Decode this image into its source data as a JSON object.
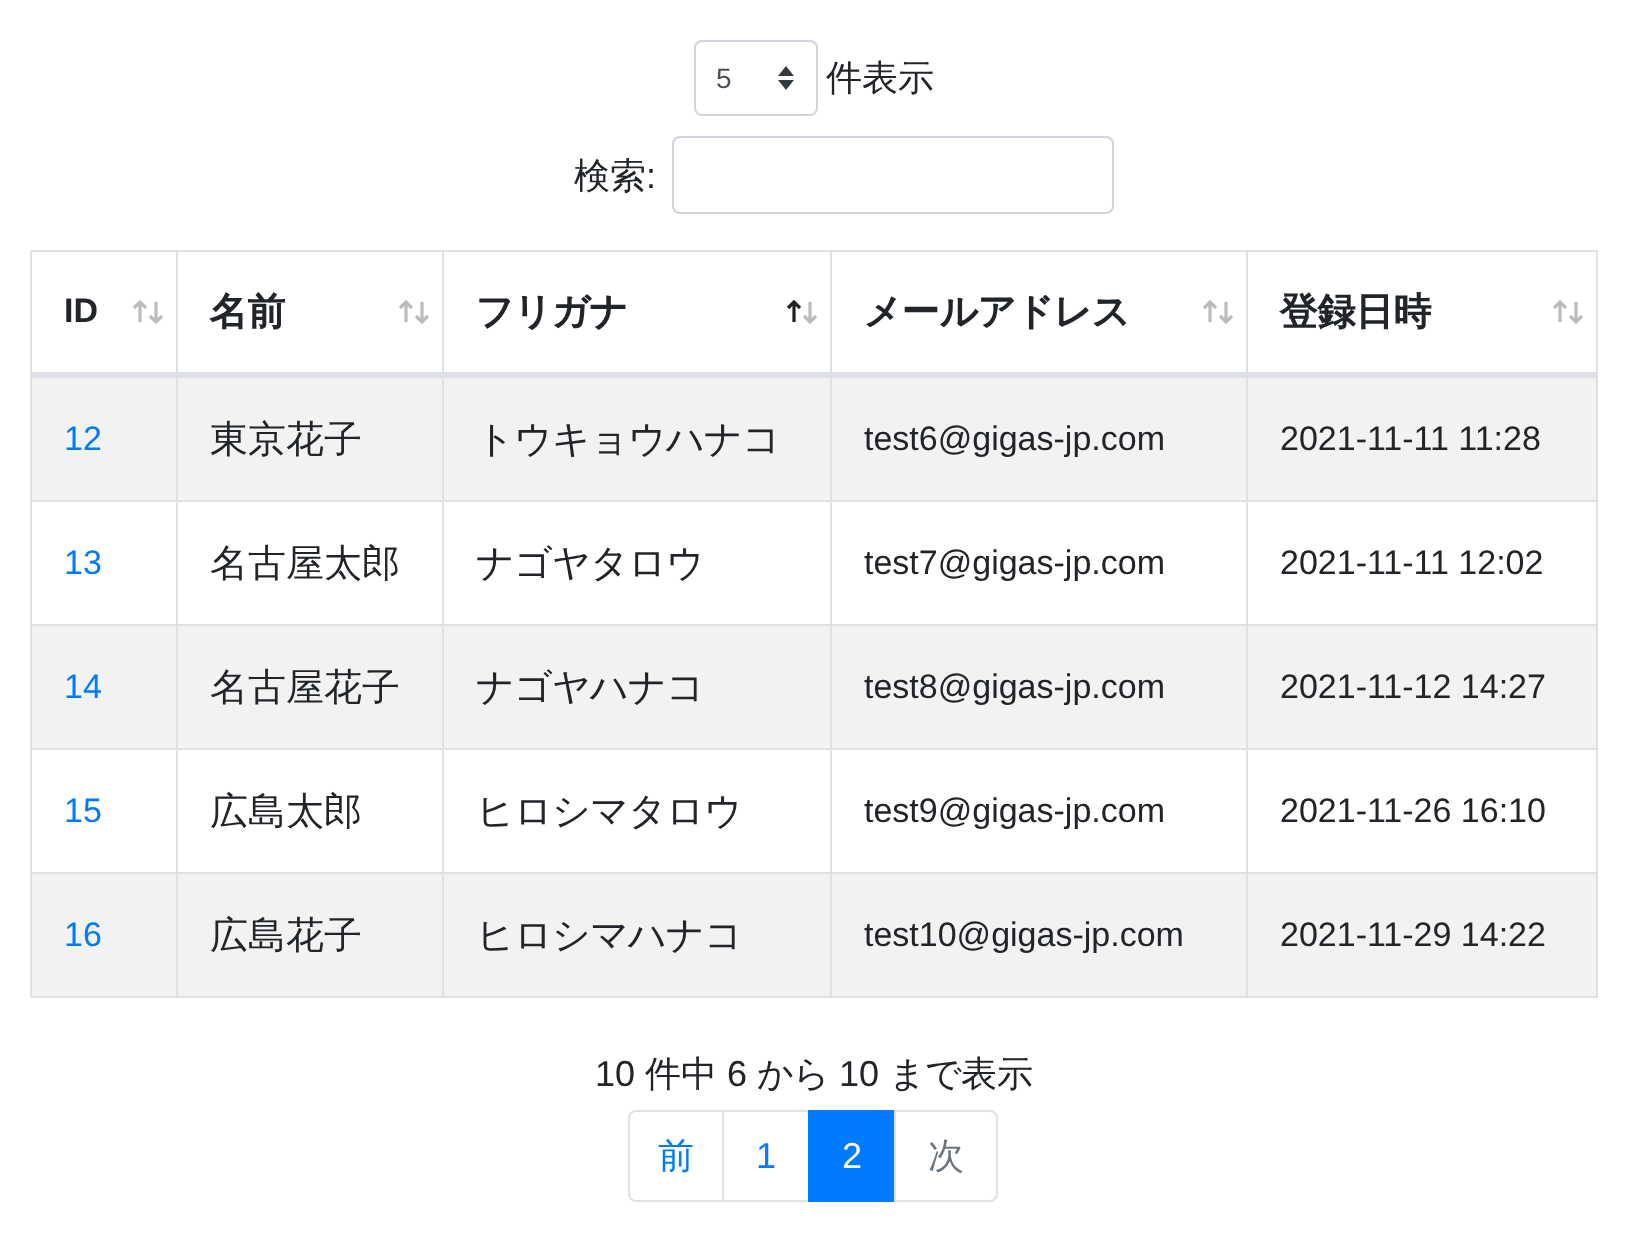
{
  "length": {
    "value": "5",
    "label": "件表示"
  },
  "search": {
    "label": "検索:"
  },
  "table": {
    "columns": [
      {
        "label": "ID",
        "sorted_ascending": false
      },
      {
        "label": "名前",
        "sorted_ascending": false
      },
      {
        "label": "フリガナ",
        "sorted_ascending": true
      },
      {
        "label": "メールアドレス",
        "sorted_ascending": false
      },
      {
        "label": "登録日時",
        "sorted_ascending": false
      }
    ],
    "rows": [
      [
        "12",
        "東京花子",
        "トウキョウハナコ",
        "test6@gigas-jp.com",
        "2021-11-11 11:28"
      ],
      [
        "13",
        "名古屋太郎",
        "ナゴヤタロウ",
        "test7@gigas-jp.com",
        "2021-11-11 12:02"
      ],
      [
        "14",
        "名古屋花子",
        "ナゴヤハナコ",
        "test8@gigas-jp.com",
        "2021-11-12 14:27"
      ],
      [
        "15",
        "広島太郎",
        "ヒロシマタロウ",
        "test9@gigas-jp.com",
        "2021-11-26 16:10"
      ],
      [
        "16",
        "広島花子",
        "ヒロシマハナコ",
        "test10@gigas-jp.com",
        "2021-11-29 14:22"
      ]
    ]
  },
  "info": "10 件中 6 から 10 まで表示",
  "pagination": [
    {
      "label": "前",
      "selected": false,
      "disabled": false
    },
    {
      "label": "1",
      "selected": false,
      "disabled": false
    },
    {
      "label": "2",
      "selected": true,
      "disabled": false
    },
    {
      "label": "次",
      "selected": false,
      "disabled": true
    }
  ]
}
